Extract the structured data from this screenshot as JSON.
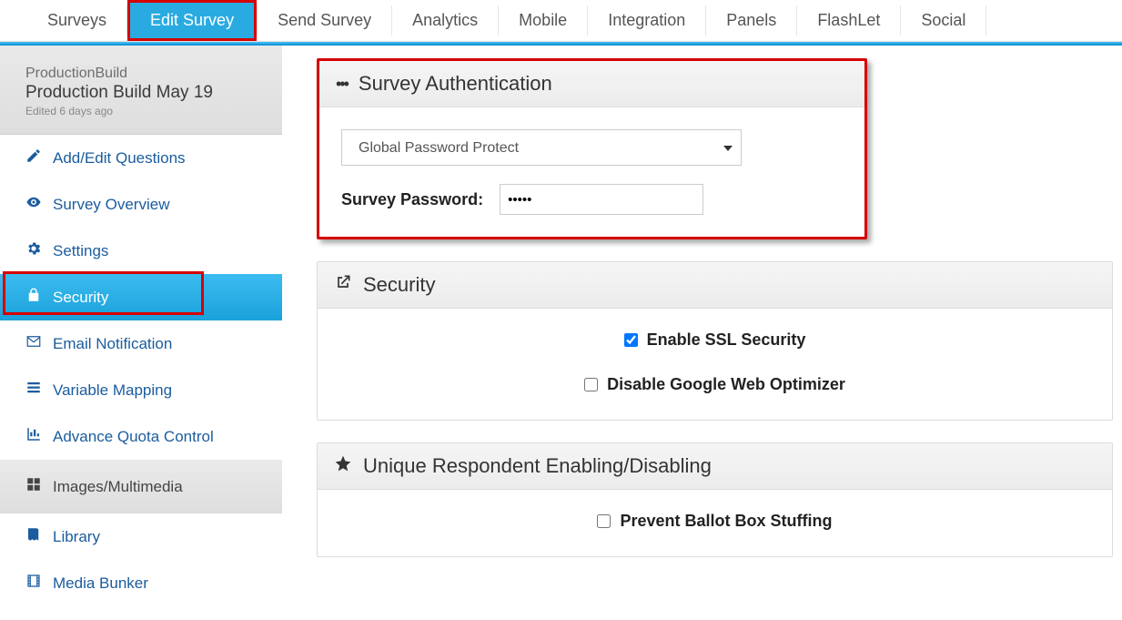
{
  "topnav": {
    "items": [
      {
        "label": "Surveys"
      },
      {
        "label": "Edit Survey"
      },
      {
        "label": "Send Survey"
      },
      {
        "label": "Analytics"
      },
      {
        "label": "Mobile"
      },
      {
        "label": "Integration"
      },
      {
        "label": "Panels"
      },
      {
        "label": "FlashLet"
      },
      {
        "label": "Social"
      }
    ]
  },
  "sidebar": {
    "breadcrumb": "ProductionBuild",
    "title": "Production Build May 19",
    "edited": "Edited 6 days ago",
    "items": [
      {
        "label": "Add/Edit Questions"
      },
      {
        "label": "Survey Overview"
      },
      {
        "label": "Settings"
      },
      {
        "label": "Security"
      },
      {
        "label": "Email Notification"
      },
      {
        "label": "Variable Mapping"
      },
      {
        "label": "Advance Quota Control"
      }
    ],
    "section": {
      "label": "Images/Multimedia"
    },
    "sub_items": [
      {
        "label": "Library"
      },
      {
        "label": "Media Bunker"
      }
    ]
  },
  "main": {
    "auth_panel": {
      "title": "Survey Authentication",
      "select_value": "Global Password Protect",
      "password_label": "Survey Password:",
      "password_value": "•••••"
    },
    "security_panel": {
      "title": "Security",
      "ssl_label": "Enable SSL Security",
      "ssl_checked": true,
      "gwo_label": "Disable Google Web Optimizer",
      "gwo_checked": false
    },
    "unique_panel": {
      "title": "Unique Respondent Enabling/Disabling",
      "ballot_label": "Prevent Ballot Box Stuffing",
      "ballot_checked": false
    }
  }
}
